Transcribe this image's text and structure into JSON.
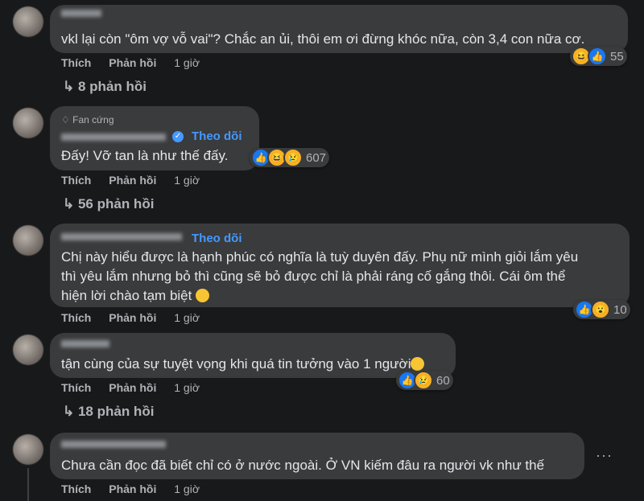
{
  "comments": [
    {
      "text": "vkl lại còn \"ôm vợ vỗ vai\"? Chắc an ủi, thôi em ơi đừng khóc nữa, còn 3,4 con nữa cơ.",
      "like": "Thích",
      "reply": "Phản hồi",
      "time": "1 giờ",
      "reactions": [
        "haha",
        "like"
      ],
      "reaction_count": "55",
      "replies": "8 phản hồi"
    },
    {
      "badge": "Fan cứng",
      "follow": "Theo dõi",
      "text": "Đấy! Vỡ tan là như thế đấy.",
      "like": "Thích",
      "reply": "Phản hồi",
      "time": "1 giờ",
      "reactions": [
        "like",
        "haha",
        "sad"
      ],
      "reaction_count": "607",
      "replies": "56 phản hồi"
    },
    {
      "follow": "Theo dõi",
      "lines": [
        "Chị này hiểu được là hạnh phúc có nghĩa là tuỳ duyên đấy. Phụ nữ mình giỏi lắm yêu",
        "thì yêu lắm nhưng bỏ thì cũng sẽ bỏ được chỉ là phải ráng cố gắng thôi. Cái ôm thể",
        "hiện lời chào tạm biệt"
      ],
      "like": "Thích",
      "reply": "Phản hồi",
      "time": "1 giờ",
      "reactions": [
        "like",
        "wow"
      ],
      "reaction_count": "10"
    },
    {
      "text": "tận cùng của sự tuyệt vọng khi quá tin tưởng vào 1 người",
      "like": "Thích",
      "reply": "Phản hồi",
      "time": "1 giờ",
      "reactions": [
        "like",
        "sad"
      ],
      "reaction_count": "60",
      "replies": "18 phản hồi"
    },
    {
      "text": "Chưa cần đọc đã biết chỉ có ở nước ngoài. Ở VN kiếm đâu ra người vk như thế",
      "like": "Thích",
      "reply": "Phản hồi",
      "time": "1 giờ"
    }
  ]
}
